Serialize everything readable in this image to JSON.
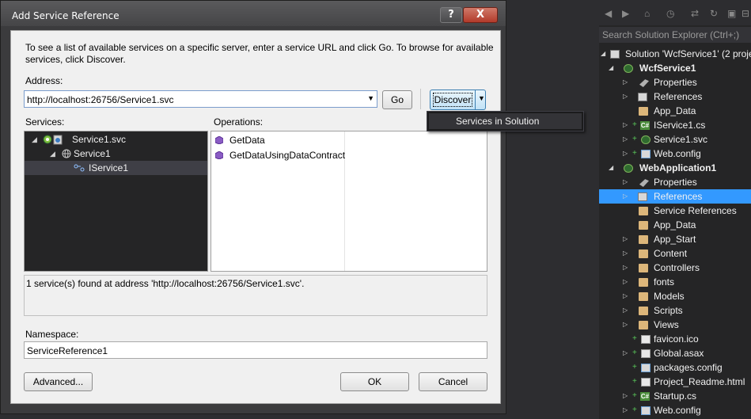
{
  "dialog": {
    "title": "Add Service Reference",
    "help_glyph": "?",
    "close_glyph": "X",
    "instructions": "To see a list of available services on a specific server, enter a service URL and click Go. To browse for available services, click Discover.",
    "address_label": "Address:",
    "address_value": "http://localhost:26756/Service1.svc",
    "go_label": "Go",
    "discover_label": "Discover",
    "services_label": "Services:",
    "operations_label": "Operations:",
    "services_tree": [
      {
        "label": "Service1.svc"
      },
      {
        "label": "Service1"
      },
      {
        "label": "IService1"
      }
    ],
    "operations": [
      {
        "label": "GetData"
      },
      {
        "label": "GetDataUsingDataContract"
      }
    ],
    "status_text": "1 service(s) found at address 'http://localhost:26756/Service1.svc'.",
    "namespace_label": "Namespace:",
    "namespace_value": "ServiceReference1",
    "advanced_label": "Advanced...",
    "ok_label": "OK",
    "cancel_label": "Cancel"
  },
  "discover_menu": {
    "items": [
      {
        "label": "Services in Solution"
      }
    ]
  },
  "solution_explorer": {
    "search_placeholder": "Search Solution Explorer (Ctrl+;)",
    "items": [
      {
        "label": "Solution 'WcfService1' (2 proje",
        "icon": "solution-icon"
      },
      {
        "label": "WcfService1",
        "icon": "web-project-icon"
      },
      {
        "label": "Properties",
        "icon": "wrench-icon"
      },
      {
        "label": "References",
        "icon": "references-icon"
      },
      {
        "label": "App_Data",
        "icon": "folder-icon"
      },
      {
        "label": "IService1.cs",
        "icon": "csharp-file-icon"
      },
      {
        "label": "Service1.svc",
        "icon": "svc-file-icon"
      },
      {
        "label": "Web.config",
        "icon": "config-file-icon"
      },
      {
        "label": "WebApplication1",
        "icon": "web-project-icon"
      },
      {
        "label": "Properties",
        "icon": "wrench-icon"
      },
      {
        "label": "References",
        "icon": "references-icon"
      },
      {
        "label": "Service References",
        "icon": "folder-icon"
      },
      {
        "label": "App_Data",
        "icon": "folder-icon"
      },
      {
        "label": "App_Start",
        "icon": "folder-icon"
      },
      {
        "label": "Content",
        "icon": "folder-icon"
      },
      {
        "label": "Controllers",
        "icon": "folder-icon"
      },
      {
        "label": "fonts",
        "icon": "folder-icon"
      },
      {
        "label": "Models",
        "icon": "folder-icon"
      },
      {
        "label": "Scripts",
        "icon": "folder-icon"
      },
      {
        "label": "Views",
        "icon": "folder-icon"
      },
      {
        "label": "favicon.ico",
        "icon": "file-icon"
      },
      {
        "label": "Global.asax",
        "icon": "file-icon"
      },
      {
        "label": "packages.config",
        "icon": "config-file-icon"
      },
      {
        "label": "Project_Readme.html",
        "icon": "html-file-icon"
      },
      {
        "label": "Startup.cs",
        "icon": "csharp-file-icon"
      },
      {
        "label": "Web.config",
        "icon": "config-file-icon"
      }
    ]
  }
}
